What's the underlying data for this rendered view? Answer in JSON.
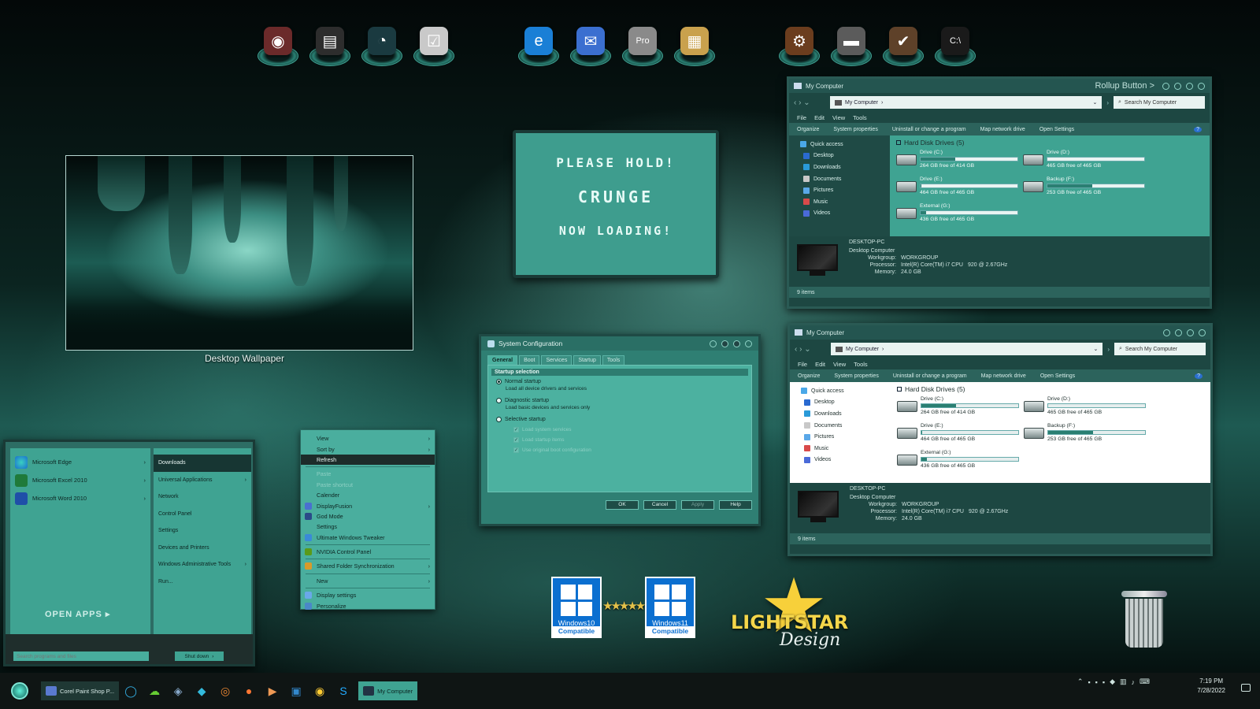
{
  "dock": {
    "group1": [
      {
        "name": "speaker-app-icon",
        "color": "#6b2a2a",
        "glyph": "◉"
      },
      {
        "name": "cassette-app-icon",
        "color": "#2d2d2d",
        "glyph": "▤"
      },
      {
        "name": "gauge-app-icon",
        "color": "#1a3a40",
        "glyph": "◔"
      },
      {
        "name": "checklist-app-icon",
        "color": "#c9c9c9",
        "glyph": "☑"
      }
    ],
    "group2": [
      {
        "name": "edge-browser-icon",
        "color": "#1a7fd6",
        "glyph": "e"
      },
      {
        "name": "thunderbird-mail-icon",
        "color": "#3b6fd0",
        "glyph": "✉"
      },
      {
        "name": "google-earth-pro-icon",
        "color": "#8a8a8a",
        "glyph": "Pro"
      },
      {
        "name": "notebook-app-icon",
        "color": "#c9a14d",
        "glyph": "▦"
      }
    ],
    "group3": [
      {
        "name": "steampunk-app-icon",
        "color": "#6b3d1e",
        "glyph": "⚙"
      },
      {
        "name": "chrome-drive-icon",
        "color": "#5b5b5b",
        "glyph": "▬"
      },
      {
        "name": "check-tool-icon",
        "color": "#5e4129",
        "glyph": "✔"
      },
      {
        "name": "terminal-app-icon",
        "color": "#1a1a1a",
        "glyph": "C:\\"
      }
    ]
  },
  "wallpaper": {
    "label": "Desktop Wallpaper"
  },
  "loading": {
    "line1": "PLEASE HOLD!",
    "line2": "CRUNGE",
    "line3": "NOW LOADING!"
  },
  "explorer1": {
    "title": "My Computer",
    "rollup": "Rollup Button >",
    "path": "My Computer",
    "search": "Search My Computer",
    "menu": [
      "File",
      "Edit",
      "View",
      "Tools"
    ],
    "commands": [
      "Organize",
      "System properties",
      "Uninstall or change a program",
      "Map network drive",
      "Open Settings"
    ],
    "nav": [
      "Quick access",
      "Desktop",
      "Downloads",
      "Documents",
      "Pictures",
      "Music",
      "Videos"
    ],
    "group": "Hard Disk Drives (5)",
    "drives": [
      {
        "name": "Drive (C:)",
        "free": "264 GB free of 414 GB",
        "used": 0.36
      },
      {
        "name": "Drive (D:)",
        "free": "465 GB free of 465 GB",
        "used": 0.0
      },
      {
        "name": "Drive (E:)",
        "free": "464 GB free of 465 GB",
        "used": 0.01
      },
      {
        "name": "Backup (F:)",
        "free": "253 GB free of 465 GB",
        "used": 0.46
      },
      {
        "name": "External (G:)",
        "free": "436 GB free of 465 GB",
        "used": 0.06
      }
    ],
    "pc": "DESKTOP-PC",
    "pctype": "Desktop Computer",
    "workgroup_k": "Workgroup:",
    "workgroup_v": "WORKGROUP",
    "processor_k": "Processor:",
    "processor_v": "Intel(R) Core(TM) i7 CPU",
    "processor_x": "920  @ 2.67GHz",
    "memory_k": "Memory:",
    "memory_v": "24.0 GB",
    "status": "9 items"
  },
  "explorer2": {
    "title": "My Computer",
    "path": "My Computer",
    "search": "Search My Computer",
    "menu": [
      "File",
      "Edit",
      "View",
      "Tools"
    ],
    "commands": [
      "Organize",
      "System properties",
      "Uninstall or change a program",
      "Map network drive",
      "Open Settings"
    ],
    "nav": [
      "Quick access",
      "Desktop",
      "Downloads",
      "Documents",
      "Pictures",
      "Music",
      "Videos"
    ],
    "group": "Hard Disk Drives (5)",
    "drives": [
      {
        "name": "Drive (C:)",
        "free": "264 GB free of 414 GB",
        "used": 0.36
      },
      {
        "name": "Drive (D:)",
        "free": "465 GB free of 465 GB",
        "used": 0.0
      },
      {
        "name": "Drive (E:)",
        "free": "464 GB free of 465 GB",
        "used": 0.01
      },
      {
        "name": "Backup (F:)",
        "free": "253 GB free of 465 GB",
        "used": 0.46
      },
      {
        "name": "External (G:)",
        "free": "436 GB free of 465 GB",
        "used": 0.06
      }
    ],
    "pc": "DESKTOP-PC",
    "pctype": "Desktop Computer",
    "workgroup_k": "Workgroup:",
    "workgroup_v": "WORKGROUP",
    "processor_k": "Processor:",
    "processor_v": "Intel(R) Core(TM) i7 CPU",
    "processor_x": "920  @ 2.67GHz",
    "memory_k": "Memory:",
    "memory_v": "24.0 GB",
    "status": "9 items"
  },
  "syscfg": {
    "title": "System Configuration",
    "tabs": [
      "General",
      "Boot",
      "Services",
      "Startup",
      "Tools"
    ],
    "group": "Startup selection",
    "normal": "Normal startup",
    "normal_sub": "Load all device drivers and services",
    "diag": "Diagnostic startup",
    "diag_sub": "Load basic devices and services only",
    "selective": "Selective startup",
    "chk1": "Load system services",
    "chk2": "Load startup items",
    "chk3": "Use original boot configuration",
    "ok": "OK",
    "cancel": "Cancel",
    "apply": "Apply",
    "help": "Help"
  },
  "context": {
    "view": "View",
    "sort": "Sort by",
    "refresh": "Refresh",
    "paste": "Paste",
    "paste_shortcut": "Paste shortcut",
    "calender": "Calender",
    "displayfusion": "DisplayFusion",
    "godmode": "God Mode",
    "settings": "Settings",
    "uwt": "Ultimate Windows Tweaker",
    "nvidia": "NVIDIA Control Panel",
    "sfs": "Shared Folder Synchronization",
    "new": "New",
    "display": "Display settings",
    "personalize": "Personalize"
  },
  "start": {
    "apps": [
      "Microsoft Edge",
      "Microsoft Excel 2010",
      "Microsoft Word 2010"
    ],
    "right": [
      "Downloads",
      "Universal Applications",
      "Network",
      "Control Panel",
      "Settings",
      "Devices and Printers",
      "Windows Administrative Tools",
      "Run..."
    ],
    "open_apps": "OPEN APPS",
    "search_placeholder": "Search programs and files",
    "shutdown": "Shut down"
  },
  "badges": {
    "win10": "Windows10",
    "win11": "Windows11",
    "compatible": "Compatible",
    "lightstar": "LIGHTSTAR",
    "design": "Design"
  },
  "taskbar": {
    "app1": "Corel Paint Shop P...",
    "app2": "My Computer",
    "time": "7:19 PM",
    "date": "7/28/2022"
  }
}
